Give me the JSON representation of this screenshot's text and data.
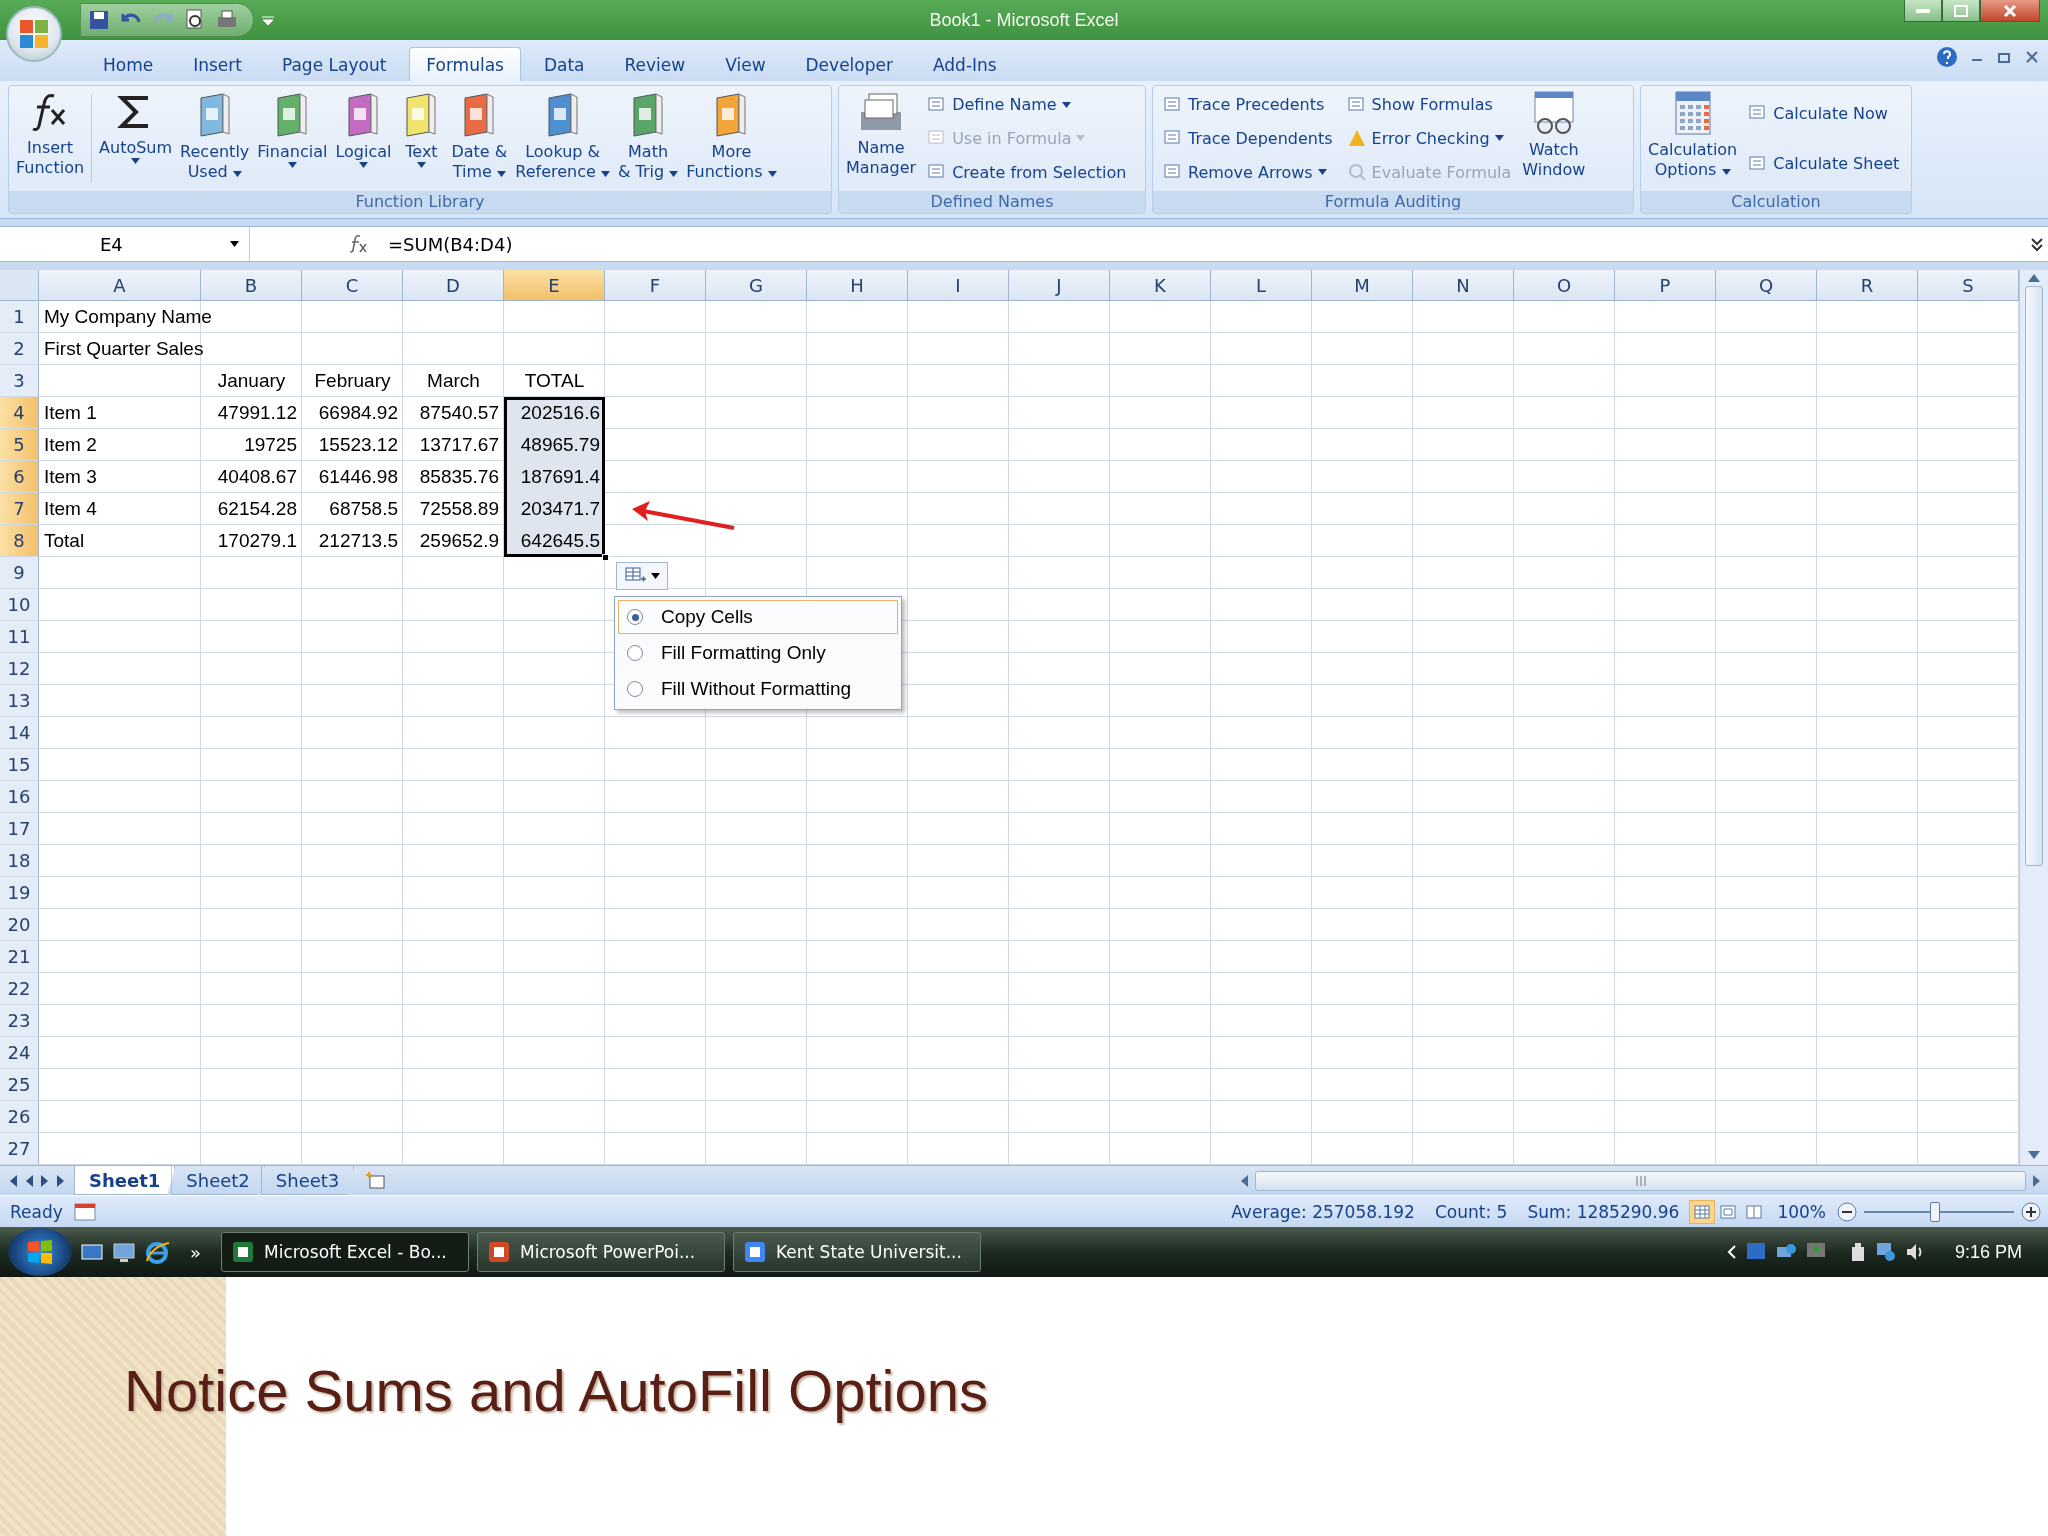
{
  "window": {
    "title": "Book1 - Microsoft Excel"
  },
  "ribbon_tabs": [
    {
      "label": "Home",
      "selected": false
    },
    {
      "label": "Insert",
      "selected": false
    },
    {
      "label": "Page Layout",
      "selected": false
    },
    {
      "label": "Formulas",
      "selected": true
    },
    {
      "label": "Data",
      "selected": false
    },
    {
      "label": "Review",
      "selected": false
    },
    {
      "label": "View",
      "selected": false
    },
    {
      "label": "Developer",
      "selected": false
    },
    {
      "label": "Add-Ins",
      "selected": false
    }
  ],
  "ribbon_groups": [
    {
      "title": "Function Library",
      "items": [
        {
          "kind": "large",
          "label": "Insert\nFunction",
          "dropdown": false,
          "disabled": false
        },
        {
          "kind": "large",
          "label": "AutoSum",
          "dropdown": true,
          "disabled": false
        },
        {
          "kind": "large",
          "label": "Recently\nUsed",
          "dropdown": true,
          "disabled": false
        },
        {
          "kind": "large",
          "label": "Financial",
          "dropdown": true,
          "disabled": false
        },
        {
          "kind": "large",
          "label": "Logical",
          "dropdown": true,
          "disabled": false
        },
        {
          "kind": "large",
          "label": "Text",
          "dropdown": true,
          "disabled": false
        },
        {
          "kind": "large",
          "label": "Date &\nTime",
          "dropdown": true,
          "disabled": false
        },
        {
          "kind": "large",
          "label": "Lookup &\nReference",
          "dropdown": true,
          "disabled": false
        },
        {
          "kind": "large",
          "label": "Math\n& Trig",
          "dropdown": true,
          "disabled": false
        },
        {
          "kind": "large",
          "label": "More\nFunctions",
          "dropdown": true,
          "disabled": false
        }
      ]
    },
    {
      "title": "Defined Names",
      "items": [
        {
          "kind": "large",
          "label": "Name\nManager",
          "dropdown": false,
          "disabled": false
        },
        {
          "kind": "small",
          "label": "Define Name",
          "dropdown": true,
          "disabled": false
        },
        {
          "kind": "small",
          "label": "Use in Formula",
          "dropdown": true,
          "disabled": true
        },
        {
          "kind": "small",
          "label": "Create from Selection",
          "dropdown": false,
          "disabled": false
        }
      ]
    },
    {
      "title": "Formula Auditing",
      "items": [
        {
          "kind": "small",
          "label": "Trace Precedents",
          "dropdown": false,
          "disabled": false
        },
        {
          "kind": "small",
          "label": "Trace Dependents",
          "dropdown": false,
          "disabled": false
        },
        {
          "kind": "small",
          "label": "Remove Arrows",
          "dropdown": true,
          "disabled": false
        },
        {
          "kind": "small",
          "label": "Show Formulas",
          "dropdown": false,
          "disabled": false
        },
        {
          "kind": "small",
          "label": "Error Checking",
          "dropdown": true,
          "disabled": false
        },
        {
          "kind": "small",
          "label": "Evaluate Formula",
          "dropdown": false,
          "disabled": true
        },
        {
          "kind": "large",
          "label": "Watch\nWindow",
          "dropdown": false,
          "disabled": false
        }
      ]
    },
    {
      "title": "Calculation",
      "items": [
        {
          "kind": "large",
          "label": "Calculation\nOptions",
          "dropdown": true,
          "disabled": false
        },
        {
          "kind": "small",
          "label": "Calculate Now",
          "dropdown": false,
          "disabled": false
        },
        {
          "kind": "small",
          "label": "Calculate Sheet",
          "dropdown": false,
          "disabled": false
        }
      ]
    }
  ],
  "formula_bar": {
    "name_box": "E4",
    "formula": "=SUM(B4:D4)"
  },
  "sheet": {
    "columns": [
      {
        "label": "A",
        "selected": false
      },
      {
        "label": "B",
        "selected": false
      },
      {
        "label": "C",
        "selected": false
      },
      {
        "label": "D",
        "selected": false
      },
      {
        "label": "E",
        "selected": true
      },
      {
        "label": "F",
        "selected": false
      },
      {
        "label": "G",
        "selected": false
      },
      {
        "label": "H",
        "selected": false
      },
      {
        "label": "I",
        "selected": false
      },
      {
        "label": "J",
        "selected": false
      },
      {
        "label": "K",
        "selected": false
      },
      {
        "label": "L",
        "selected": false
      },
      {
        "label": "M",
        "selected": false
      },
      {
        "label": "N",
        "selected": false
      },
      {
        "label": "O",
        "selected": false
      },
      {
        "label": "P",
        "selected": false
      },
      {
        "label": "Q",
        "selected": false
      },
      {
        "label": "R",
        "selected": false
      },
      {
        "label": "S",
        "selected": false
      }
    ],
    "rows": [
      {
        "header": "1",
        "kind": "text",
        "selected": false,
        "cells": [
          "My Company Name"
        ]
      },
      {
        "header": "2",
        "kind": "text",
        "selected": false,
        "cells": [
          "First Quarter Sales"
        ]
      },
      {
        "header": "3",
        "kind": "heading",
        "selected": false,
        "cells": [
          null,
          "January",
          "February",
          "March",
          "TOTAL"
        ]
      },
      {
        "header": "4",
        "kind": "data",
        "selected": true,
        "cells": [
          "Item 1",
          "47991.12",
          "66984.92",
          "87540.57",
          "202516.6"
        ]
      },
      {
        "header": "5",
        "kind": "data",
        "selected": true,
        "cells": [
          "Item 2",
          "19725",
          "15523.12",
          "13717.67",
          "48965.79"
        ]
      },
      {
        "header": "6",
        "kind": "data",
        "selected": true,
        "cells": [
          "Item 3",
          "40408.67",
          "61446.98",
          "85835.76",
          "187691.4"
        ]
      },
      {
        "header": "7",
        "kind": "data",
        "selected": true,
        "cells": [
          "Item 4",
          "62154.28",
          "68758.5",
          "72558.89",
          "203471.7"
        ]
      },
      {
        "header": "8",
        "kind": "data",
        "selected": true,
        "cells": [
          "Total",
          "170279.1",
          "212713.5",
          "259652.9",
          "642645.5"
        ]
      },
      {
        "header": "9",
        "kind": "text",
        "selected": false
      },
      {
        "header": "10",
        "kind": "text",
        "selected": false
      },
      {
        "header": "11",
        "kind": "text",
        "selected": false
      },
      {
        "header": "12",
        "kind": "text",
        "selected": false
      },
      {
        "header": "13",
        "kind": "text",
        "selected": false
      },
      {
        "header": "14",
        "kind": "text",
        "selected": false
      },
      {
        "header": "15",
        "kind": "text",
        "selected": false
      },
      {
        "header": "16",
        "kind": "text",
        "selected": false
      },
      {
        "header": "17",
        "kind": "text",
        "selected": false
      },
      {
        "header": "18",
        "kind": "text",
        "selected": false
      },
      {
        "header": "19",
        "kind": "text",
        "selected": false
      },
      {
        "header": "20",
        "kind": "text",
        "selected": false
      },
      {
        "header": "21",
        "kind": "text",
        "selected": false
      },
      {
        "header": "22",
        "kind": "text",
        "selected": false
      },
      {
        "header": "23",
        "kind": "text",
        "selected": false
      },
      {
        "header": "24",
        "kind": "text",
        "selected": false
      },
      {
        "header": "25",
        "kind": "text",
        "selected": false
      },
      {
        "header": "26",
        "kind": "text",
        "selected": false
      },
      {
        "header": "27",
        "kind": "text",
        "selected": false
      }
    ]
  },
  "autofill_menu": {
    "options": [
      {
        "label": "Copy Cells",
        "selected": true
      },
      {
        "label": "Fill Formatting Only",
        "selected": false
      },
      {
        "label": "Fill Without Formatting",
        "selected": false
      }
    ]
  },
  "sheet_tabs": [
    {
      "label": "Sheet1",
      "selected": true
    },
    {
      "label": "Sheet2",
      "selected": false
    },
    {
      "label": "Sheet3",
      "selected": false
    }
  ],
  "status_bar": {
    "mode": "Ready",
    "average": "Average: 257058.192",
    "count": "Count: 5",
    "sum": "Sum: 1285290.96",
    "view_buttons": [
      {
        "selected": true
      },
      {
        "selected": false
      },
      {
        "selected": false
      }
    ],
    "zoom": "100%",
    "zoom_level": {
      "level": 0.47
    }
  },
  "taskbar": {
    "more": "»",
    "buttons": [
      {
        "label": "Microsoft Excel - Bo...",
        "selected": true
      },
      {
        "label": "Microsoft PowerPoi...",
        "selected": false
      },
      {
        "label": "Kent State Universit...",
        "selected": false
      }
    ],
    "clock": "9:16 PM"
  },
  "slide": {
    "title": "Notice Sums and AutoFill Options"
  }
}
